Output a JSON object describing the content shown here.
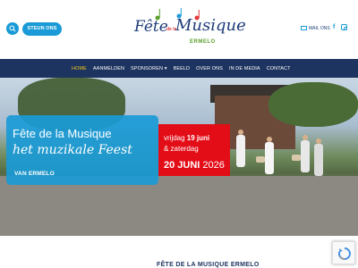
{
  "header": {
    "cta_label": "STEUN ONS",
    "logo": {
      "fete": "Fête",
      "dela": "de la",
      "musique": "Musique",
      "city": "ERMELO"
    },
    "mail_label": "MAIL ONS",
    "fb_glyph": "f"
  },
  "nav": {
    "items": [
      {
        "label": "HOME"
      },
      {
        "label": "AANMELDEN"
      },
      {
        "label": "SPONSOREN ▾"
      },
      {
        "label": "BEELD"
      },
      {
        "label": "OVER ONS"
      },
      {
        "label": "IN DE MEDIA"
      },
      {
        "label": "CONTACT"
      }
    ],
    "active_color": "#f5c518"
  },
  "hero": {
    "title": "Fête de la Musique",
    "subtitle": "het muzikale Feest",
    "city": "VAN ERMELO",
    "date_line1_prefix": "vrijdag ",
    "date_line1_bold": "19 juni",
    "date_line2": "& zaterdag",
    "date_line3_bold": "20 JUNI",
    "date_line3_year": " 2026",
    "blue_color": "#1a9ad6",
    "red_color": "#e30d17"
  },
  "section": {
    "title": "FÊTE DE LA MUSIQUE ERMELO"
  },
  "icons": {
    "search": "search-icon",
    "mail": "mail-icon",
    "facebook": "facebook-icon",
    "instagram": "instagram-icon",
    "recaptcha": "recaptcha-icon"
  }
}
